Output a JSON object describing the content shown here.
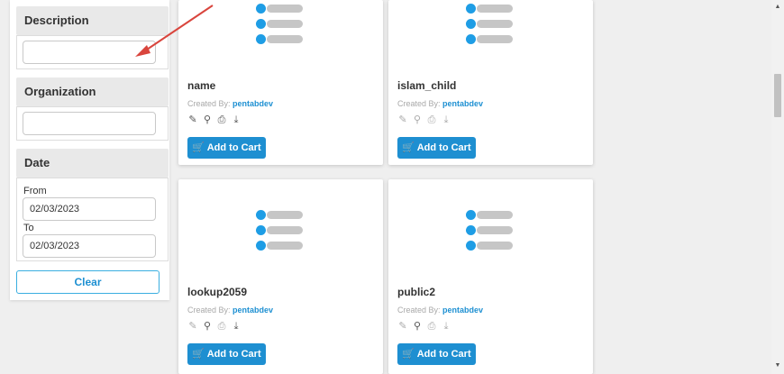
{
  "filters": {
    "description": {
      "label": "Description",
      "value": ""
    },
    "organization": {
      "label": "Organization",
      "value": ""
    },
    "date": {
      "label": "Date",
      "from_label": "From",
      "from_value": "02/03/2023",
      "to_label": "To",
      "to_value": "02/03/2023"
    },
    "clear_label": "Clear"
  },
  "cards": [
    {
      "name": "name",
      "created_by_label": "Created By:",
      "created_by": "pentabdev",
      "cart_label": "Add to Cart"
    },
    {
      "name": "islam_child",
      "created_by_label": "Created By:",
      "created_by": "pentabdev",
      "cart_label": "Add to Cart"
    },
    {
      "name": "lookup2059",
      "created_by_label": "Created By:",
      "created_by": "pentabdev",
      "cart_label": "Add to Cart"
    },
    {
      "name": "public2",
      "created_by_label": "Created By:",
      "created_by": "pentabdev",
      "cart_label": "Add to Cart"
    }
  ],
  "colors": {
    "accent": "#1e8fd1",
    "annotation_arrow": "#d9453d"
  },
  "icons": [
    "edit-icon",
    "search-icon",
    "print-icon",
    "download-icon",
    "cart-icon"
  ]
}
